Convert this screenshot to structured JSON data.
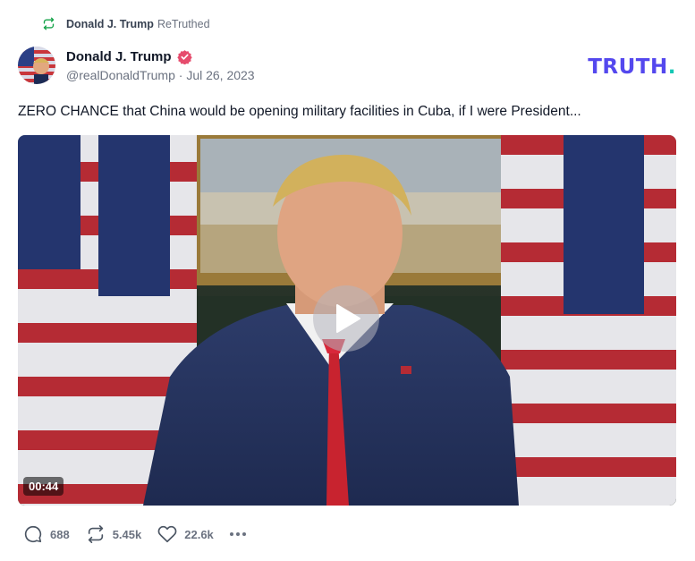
{
  "retruth": {
    "icon": "retruth-icon",
    "name": "Donald J. Trump",
    "suffix": "ReTruthed",
    "color": "#16a34a"
  },
  "post": {
    "author": {
      "display_name": "Donald J. Trump",
      "verified_icon": "verified-badge-icon",
      "handle": "@realDonaldTrump",
      "separator": "·",
      "date": "Jul 26, 2023"
    },
    "text": "ZERO CHANCE that China would be opening military facilities in Cuba, if I were President...",
    "video": {
      "duration": "00:44",
      "play_icon": "play-icon"
    }
  },
  "brand": {
    "logo_text": "TRUTH",
    "logo_dot": ".",
    "color": "#5448ee",
    "dot_color": "#14c8b4"
  },
  "actions": {
    "reply": {
      "icon": "reply-icon",
      "count": "688"
    },
    "retruth": {
      "icon": "retruth-icon",
      "count": "5.45k"
    },
    "like": {
      "icon": "heart-icon",
      "count": "22.6k"
    },
    "more": {
      "icon": "more-icon"
    }
  }
}
